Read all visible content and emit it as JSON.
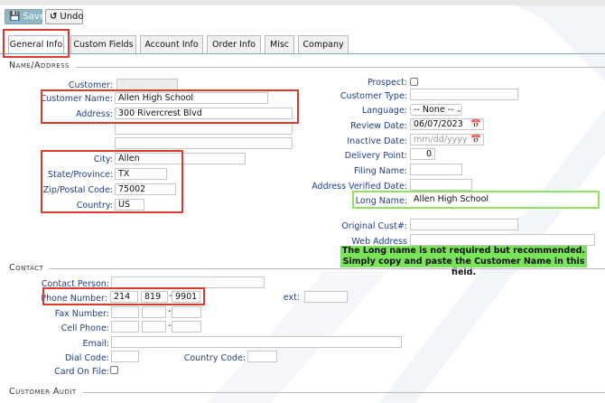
{
  "toolbar": {
    "save_label": "Save",
    "undo_label": "Undo"
  },
  "tabs": [
    "General Info",
    "Custom Fields",
    "Account Info",
    "Order Info",
    "Misc",
    "Company"
  ],
  "sections": {
    "name_address": "Name/Address",
    "contact": "Contact",
    "customer_audit": "Customer Audit"
  },
  "name_address": {
    "customer_label": "Customer:",
    "customer_name_label": "Customer Name:",
    "customer_name": "Allen High School",
    "address_label": "Address:",
    "address": "300 Rivercrest Blvd",
    "city_label": "City:",
    "city": "Allen",
    "state_label": "State/Province:",
    "state": "TX",
    "zip_label": "Zip/Postal Code:",
    "zip": "75002",
    "country_label": "Country:",
    "country": "US"
  },
  "right": {
    "prospect_label": "Prospect:",
    "customer_type_label": "Customer Type:",
    "language_label": "Language:",
    "language_value": "-- None --",
    "review_date_label": "Review Date:",
    "review_date": "06/07/2023",
    "inactive_date_label": "Inactive Date:",
    "inactive_date_placeholder": "mm/dd/yyyy",
    "delivery_point_label": "Delivery Point:",
    "delivery_point": "0",
    "filing_name_label": "Filing Name:",
    "address_verified_label": "Address Verified Date:",
    "long_name_label": "Long Name:",
    "long_name": "Allen High School",
    "original_cust_label": "Original Cust#:",
    "web_address_label": "Web Address"
  },
  "note": {
    "line1": "The Long name is not required but recommended.",
    "line2": "Simply copy and paste the Customer Name in this field."
  },
  "contact": {
    "contact_person_label": "Contact Person:",
    "phone_label": "Phone Number:",
    "phone_area": "214",
    "phone_prefix": "819",
    "phone_line": "9901",
    "ext_label": "ext:",
    "fax_label": "Fax Number:",
    "cell_label": "Cell Phone:",
    "email_label": "Email:",
    "dial_code_label": "Dial Code:",
    "country_code_label": "Country Code:",
    "card_on_file_label": "Card On File:"
  },
  "colors": {
    "highlight_red": "#e0392b",
    "highlight_green": "#8fe361",
    "note_bg": "#79e35a",
    "label_blue": "#1f3f86"
  },
  "icons": [
    "save-icon",
    "undo-icon",
    "calendar-icon",
    "chevron-down-icon",
    "checkbox-icon",
    "watermark"
  ]
}
